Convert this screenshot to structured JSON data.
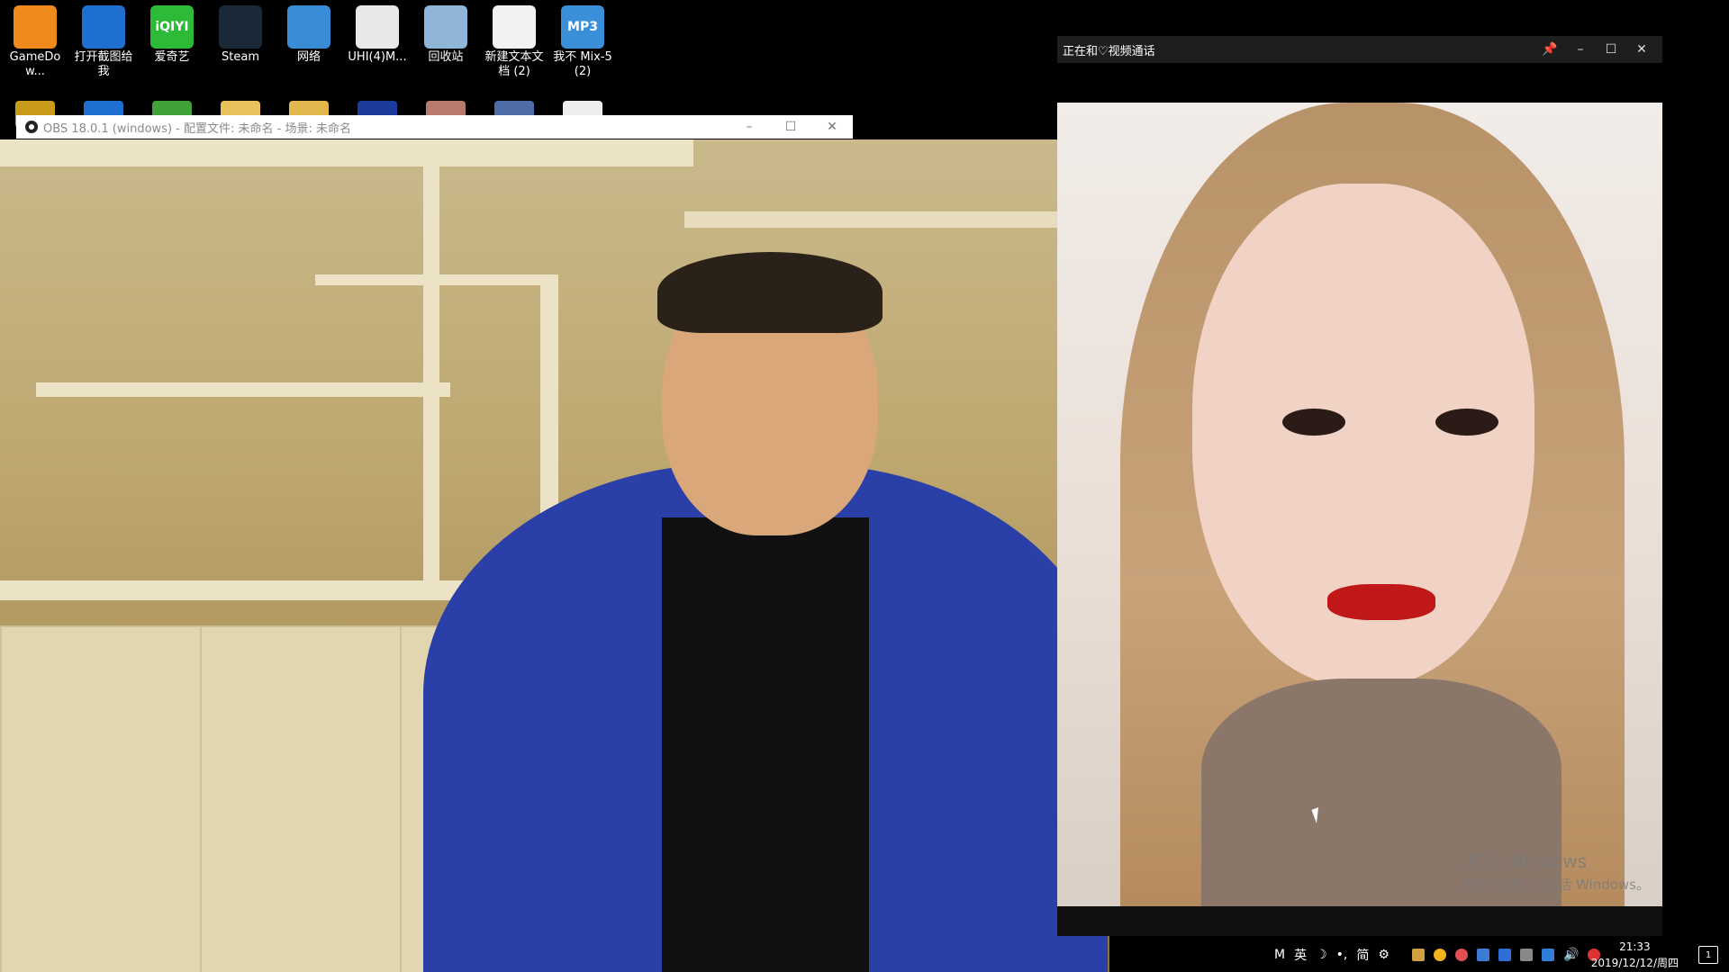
{
  "desktop": {
    "row1": [
      {
        "label": "GameDow...",
        "icon": "gamedownloader-icon",
        "color": "#f08a1c"
      },
      {
        "label": "打开截图给我",
        "icon": "teamviewer-icon",
        "color": "#1f6fd1"
      },
      {
        "label": "爱奇艺",
        "icon": "iqiyi-icon",
        "color": "#2dbb37",
        "glyph": "iQIYI"
      },
      {
        "label": "Steam",
        "icon": "steam-icon",
        "color": "#1b2838"
      },
      {
        "label": "网络",
        "icon": "network-icon",
        "color": "#3a8bd8"
      },
      {
        "label": "UHI(4)M...",
        "icon": "image-file-icon",
        "color": "#e8e8e8"
      },
      {
        "label": "回收站",
        "icon": "recycle-bin-icon",
        "color": "#8fb6d8"
      },
      {
        "label": "新建文本文档 (2)",
        "icon": "text-document-icon",
        "color": "#f2f2f2"
      },
      {
        "label": "我不 Mix-5(2)",
        "icon": "mp3-file-icon",
        "color": "#3b8fd9",
        "glyph": "MP3"
      }
    ],
    "row2": [
      {
        "icon": "app-shortcut-icon",
        "color": "#c89a1a"
      },
      {
        "icon": "teamviewer-icon",
        "color": "#1f6fd1"
      },
      {
        "icon": "xbox-icon",
        "color": "#3fa33a"
      },
      {
        "icon": "folder-icon",
        "color": "#e9c15a"
      },
      {
        "icon": "folder-icon",
        "color": "#e2b84e"
      },
      {
        "icon": "app-shortcut-icon",
        "color": "#1b3c9c"
      },
      {
        "icon": "image-file-icon",
        "color": "#b87a6a"
      },
      {
        "icon": "game-shortcut-icon",
        "color": "#4d6ca8"
      },
      {
        "icon": "document-icon",
        "color": "#eeeeee"
      }
    ]
  },
  "obs": {
    "title": "OBS 18.0.1 (windows) - 配置文件: 未命名 - 场景: 未命名",
    "minimize": "–",
    "maximize": "☐",
    "close": "✕"
  },
  "call": {
    "title": "正在和♡视频通话",
    "pin": "📌",
    "minimize": "–",
    "maximize": "☐",
    "close": "✕",
    "watermark_line1": "激活 Windows",
    "watermark_line2": "转到\"设置\"以激活 Windows。"
  },
  "taskbar": {
    "ime_mode": "M",
    "ime_lang": "英",
    "ime_moon": "☽",
    "ime_punct": "•,",
    "ime_simplified": "简",
    "ime_settings": "⚙",
    "volume": "🔊",
    "time": "21:33",
    "date": "2019/12/12/周四",
    "notifications": "1"
  }
}
